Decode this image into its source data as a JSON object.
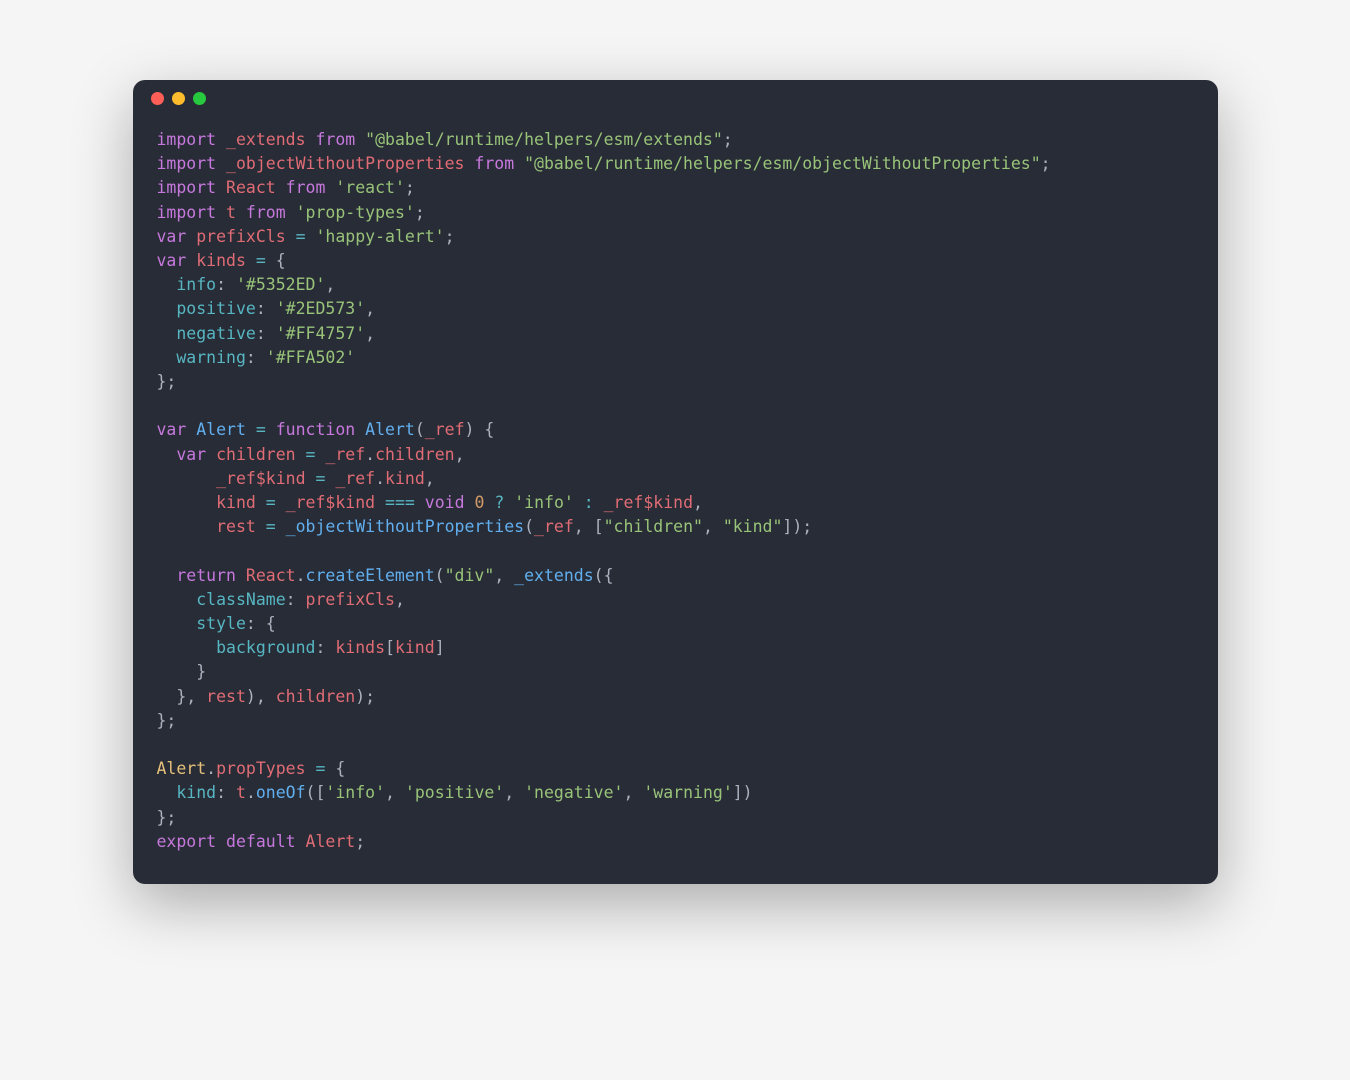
{
  "window": {
    "dots": [
      "red",
      "yellow",
      "green"
    ]
  },
  "code": {
    "lines": [
      {
        "tokens": [
          {
            "t": "kw",
            "v": "import"
          },
          {
            "t": "punct",
            "v": " "
          },
          {
            "t": "ident",
            "v": "_extends"
          },
          {
            "t": "punct",
            "v": " "
          },
          {
            "t": "kw",
            "v": "from"
          },
          {
            "t": "punct",
            "v": " "
          },
          {
            "t": "str",
            "v": "\"@babel/runtime/helpers/esm/extends\""
          },
          {
            "t": "punct",
            "v": ";"
          }
        ]
      },
      {
        "tokens": [
          {
            "t": "kw",
            "v": "import"
          },
          {
            "t": "punct",
            "v": " "
          },
          {
            "t": "ident",
            "v": "_objectWithoutProperties"
          },
          {
            "t": "punct",
            "v": " "
          },
          {
            "t": "kw",
            "v": "from"
          },
          {
            "t": "punct",
            "v": " "
          },
          {
            "t": "str",
            "v": "\"@babel/runtime/helpers/esm/objectWithoutProperties\""
          },
          {
            "t": "punct",
            "v": ";"
          }
        ]
      },
      {
        "tokens": [
          {
            "t": "kw",
            "v": "import"
          },
          {
            "t": "punct",
            "v": " "
          },
          {
            "t": "ident",
            "v": "React"
          },
          {
            "t": "punct",
            "v": " "
          },
          {
            "t": "kw",
            "v": "from"
          },
          {
            "t": "punct",
            "v": " "
          },
          {
            "t": "str",
            "v": "'react'"
          },
          {
            "t": "punct",
            "v": ";"
          }
        ]
      },
      {
        "tokens": [
          {
            "t": "kw",
            "v": "import"
          },
          {
            "t": "punct",
            "v": " "
          },
          {
            "t": "ident",
            "v": "t"
          },
          {
            "t": "punct",
            "v": " "
          },
          {
            "t": "kw",
            "v": "from"
          },
          {
            "t": "punct",
            "v": " "
          },
          {
            "t": "str",
            "v": "'prop-types'"
          },
          {
            "t": "punct",
            "v": ";"
          }
        ]
      },
      {
        "tokens": [
          {
            "t": "kw",
            "v": "var"
          },
          {
            "t": "punct",
            "v": " "
          },
          {
            "t": "ident",
            "v": "prefixCls"
          },
          {
            "t": "punct",
            "v": " "
          },
          {
            "t": "prop",
            "v": "="
          },
          {
            "t": "punct",
            "v": " "
          },
          {
            "t": "str",
            "v": "'happy-alert'"
          },
          {
            "t": "punct",
            "v": ";"
          }
        ]
      },
      {
        "tokens": [
          {
            "t": "kw",
            "v": "var"
          },
          {
            "t": "punct",
            "v": " "
          },
          {
            "t": "ident",
            "v": "kinds"
          },
          {
            "t": "punct",
            "v": " "
          },
          {
            "t": "prop",
            "v": "="
          },
          {
            "t": "punct",
            "v": " {"
          }
        ]
      },
      {
        "tokens": [
          {
            "t": "punct",
            "v": "  "
          },
          {
            "t": "prop",
            "v": "info"
          },
          {
            "t": "punct",
            "v": ": "
          },
          {
            "t": "str",
            "v": "'#5352ED'"
          },
          {
            "t": "punct",
            "v": ","
          }
        ]
      },
      {
        "tokens": [
          {
            "t": "punct",
            "v": "  "
          },
          {
            "t": "prop",
            "v": "positive"
          },
          {
            "t": "punct",
            "v": ": "
          },
          {
            "t": "str",
            "v": "'#2ED573'"
          },
          {
            "t": "punct",
            "v": ","
          }
        ]
      },
      {
        "tokens": [
          {
            "t": "punct",
            "v": "  "
          },
          {
            "t": "prop",
            "v": "negative"
          },
          {
            "t": "punct",
            "v": ": "
          },
          {
            "t": "str",
            "v": "'#FF4757'"
          },
          {
            "t": "punct",
            "v": ","
          }
        ]
      },
      {
        "tokens": [
          {
            "t": "punct",
            "v": "  "
          },
          {
            "t": "prop",
            "v": "warning"
          },
          {
            "t": "punct",
            "v": ": "
          },
          {
            "t": "str",
            "v": "'#FFA502'"
          }
        ]
      },
      {
        "tokens": [
          {
            "t": "punct",
            "v": "};"
          }
        ]
      },
      {
        "tokens": [
          {
            "t": "punct",
            "v": ""
          }
        ]
      },
      {
        "tokens": [
          {
            "t": "kw",
            "v": "var"
          },
          {
            "t": "punct",
            "v": " "
          },
          {
            "t": "func",
            "v": "Alert"
          },
          {
            "t": "punct",
            "v": " "
          },
          {
            "t": "prop",
            "v": "="
          },
          {
            "t": "punct",
            "v": " "
          },
          {
            "t": "kw",
            "v": "function"
          },
          {
            "t": "punct",
            "v": " "
          },
          {
            "t": "func",
            "v": "Alert"
          },
          {
            "t": "punct",
            "v": "("
          },
          {
            "t": "ident",
            "v": "_ref"
          },
          {
            "t": "punct",
            "v": ") {"
          }
        ]
      },
      {
        "tokens": [
          {
            "t": "punct",
            "v": "  "
          },
          {
            "t": "kw",
            "v": "var"
          },
          {
            "t": "punct",
            "v": " "
          },
          {
            "t": "ident",
            "v": "children"
          },
          {
            "t": "punct",
            "v": " "
          },
          {
            "t": "prop",
            "v": "="
          },
          {
            "t": "punct",
            "v": " "
          },
          {
            "t": "ident",
            "v": "_ref"
          },
          {
            "t": "punct",
            "v": "."
          },
          {
            "t": "ident",
            "v": "children"
          },
          {
            "t": "punct",
            "v": ","
          }
        ]
      },
      {
        "tokens": [
          {
            "t": "punct",
            "v": "      "
          },
          {
            "t": "ident",
            "v": "_ref$kind"
          },
          {
            "t": "punct",
            "v": " "
          },
          {
            "t": "prop",
            "v": "="
          },
          {
            "t": "punct",
            "v": " "
          },
          {
            "t": "ident",
            "v": "_ref"
          },
          {
            "t": "punct",
            "v": "."
          },
          {
            "t": "ident",
            "v": "kind"
          },
          {
            "t": "punct",
            "v": ","
          }
        ]
      },
      {
        "tokens": [
          {
            "t": "punct",
            "v": "      "
          },
          {
            "t": "ident",
            "v": "kind"
          },
          {
            "t": "punct",
            "v": " "
          },
          {
            "t": "prop",
            "v": "="
          },
          {
            "t": "punct",
            "v": " "
          },
          {
            "t": "ident",
            "v": "_ref$kind"
          },
          {
            "t": "punct",
            "v": " "
          },
          {
            "t": "prop",
            "v": "==="
          },
          {
            "t": "punct",
            "v": " "
          },
          {
            "t": "kw",
            "v": "void"
          },
          {
            "t": "punct",
            "v": " "
          },
          {
            "t": "num",
            "v": "0"
          },
          {
            "t": "punct",
            "v": " "
          },
          {
            "t": "prop",
            "v": "?"
          },
          {
            "t": "punct",
            "v": " "
          },
          {
            "t": "str",
            "v": "'info'"
          },
          {
            "t": "punct",
            "v": " "
          },
          {
            "t": "prop",
            "v": ":"
          },
          {
            "t": "punct",
            "v": " "
          },
          {
            "t": "ident",
            "v": "_ref$kind"
          },
          {
            "t": "punct",
            "v": ","
          }
        ]
      },
      {
        "tokens": [
          {
            "t": "punct",
            "v": "      "
          },
          {
            "t": "ident",
            "v": "rest"
          },
          {
            "t": "punct",
            "v": " "
          },
          {
            "t": "prop",
            "v": "="
          },
          {
            "t": "punct",
            "v": " "
          },
          {
            "t": "func",
            "v": "_objectWithoutProperties"
          },
          {
            "t": "punct",
            "v": "("
          },
          {
            "t": "ident",
            "v": "_ref"
          },
          {
            "t": "punct",
            "v": ", ["
          },
          {
            "t": "str",
            "v": "\"children\""
          },
          {
            "t": "punct",
            "v": ", "
          },
          {
            "t": "str",
            "v": "\"kind\""
          },
          {
            "t": "punct",
            "v": "]);"
          }
        ]
      },
      {
        "tokens": [
          {
            "t": "punct",
            "v": ""
          }
        ]
      },
      {
        "tokens": [
          {
            "t": "punct",
            "v": "  "
          },
          {
            "t": "kw",
            "v": "return"
          },
          {
            "t": "punct",
            "v": " "
          },
          {
            "t": "ident",
            "v": "React"
          },
          {
            "t": "punct",
            "v": "."
          },
          {
            "t": "func",
            "v": "createElement"
          },
          {
            "t": "punct",
            "v": "("
          },
          {
            "t": "str",
            "v": "\"div\""
          },
          {
            "t": "punct",
            "v": ", "
          },
          {
            "t": "func",
            "v": "_extends"
          },
          {
            "t": "punct",
            "v": "({"
          }
        ]
      },
      {
        "tokens": [
          {
            "t": "punct",
            "v": "    "
          },
          {
            "t": "prop",
            "v": "className"
          },
          {
            "t": "punct",
            "v": ": "
          },
          {
            "t": "ident",
            "v": "prefixCls"
          },
          {
            "t": "punct",
            "v": ","
          }
        ]
      },
      {
        "tokens": [
          {
            "t": "punct",
            "v": "    "
          },
          {
            "t": "prop",
            "v": "style"
          },
          {
            "t": "punct",
            "v": ": {"
          }
        ]
      },
      {
        "tokens": [
          {
            "t": "punct",
            "v": "      "
          },
          {
            "t": "prop",
            "v": "background"
          },
          {
            "t": "punct",
            "v": ": "
          },
          {
            "t": "ident",
            "v": "kinds"
          },
          {
            "t": "punct",
            "v": "["
          },
          {
            "t": "ident",
            "v": "kind"
          },
          {
            "t": "punct",
            "v": "]"
          }
        ]
      },
      {
        "tokens": [
          {
            "t": "punct",
            "v": "    }"
          }
        ]
      },
      {
        "tokens": [
          {
            "t": "punct",
            "v": "  }, "
          },
          {
            "t": "ident",
            "v": "rest"
          },
          {
            "t": "punct",
            "v": "), "
          },
          {
            "t": "ident",
            "v": "children"
          },
          {
            "t": "punct",
            "v": ");"
          }
        ]
      },
      {
        "tokens": [
          {
            "t": "punct",
            "v": "};"
          }
        ]
      },
      {
        "tokens": [
          {
            "t": "punct",
            "v": ""
          }
        ]
      },
      {
        "tokens": [
          {
            "t": "ident2",
            "v": "Alert"
          },
          {
            "t": "punct",
            "v": "."
          },
          {
            "t": "ident",
            "v": "propTypes"
          },
          {
            "t": "punct",
            "v": " "
          },
          {
            "t": "prop",
            "v": "="
          },
          {
            "t": "punct",
            "v": " {"
          }
        ]
      },
      {
        "tokens": [
          {
            "t": "punct",
            "v": "  "
          },
          {
            "t": "prop",
            "v": "kind"
          },
          {
            "t": "punct",
            "v": ": "
          },
          {
            "t": "ident",
            "v": "t"
          },
          {
            "t": "punct",
            "v": "."
          },
          {
            "t": "func",
            "v": "oneOf"
          },
          {
            "t": "punct",
            "v": "(["
          },
          {
            "t": "str",
            "v": "'info'"
          },
          {
            "t": "punct",
            "v": ", "
          },
          {
            "t": "str",
            "v": "'positive'"
          },
          {
            "t": "punct",
            "v": ", "
          },
          {
            "t": "str",
            "v": "'negative'"
          },
          {
            "t": "punct",
            "v": ", "
          },
          {
            "t": "str",
            "v": "'warning'"
          },
          {
            "t": "punct",
            "v": "])"
          }
        ]
      },
      {
        "tokens": [
          {
            "t": "punct",
            "v": "};"
          }
        ]
      },
      {
        "tokens": [
          {
            "t": "kw",
            "v": "export"
          },
          {
            "t": "punct",
            "v": " "
          },
          {
            "t": "kw",
            "v": "default"
          },
          {
            "t": "punct",
            "v": " "
          },
          {
            "t": "ident",
            "v": "Alert"
          },
          {
            "t": "punct",
            "v": ";"
          }
        ]
      }
    ]
  }
}
